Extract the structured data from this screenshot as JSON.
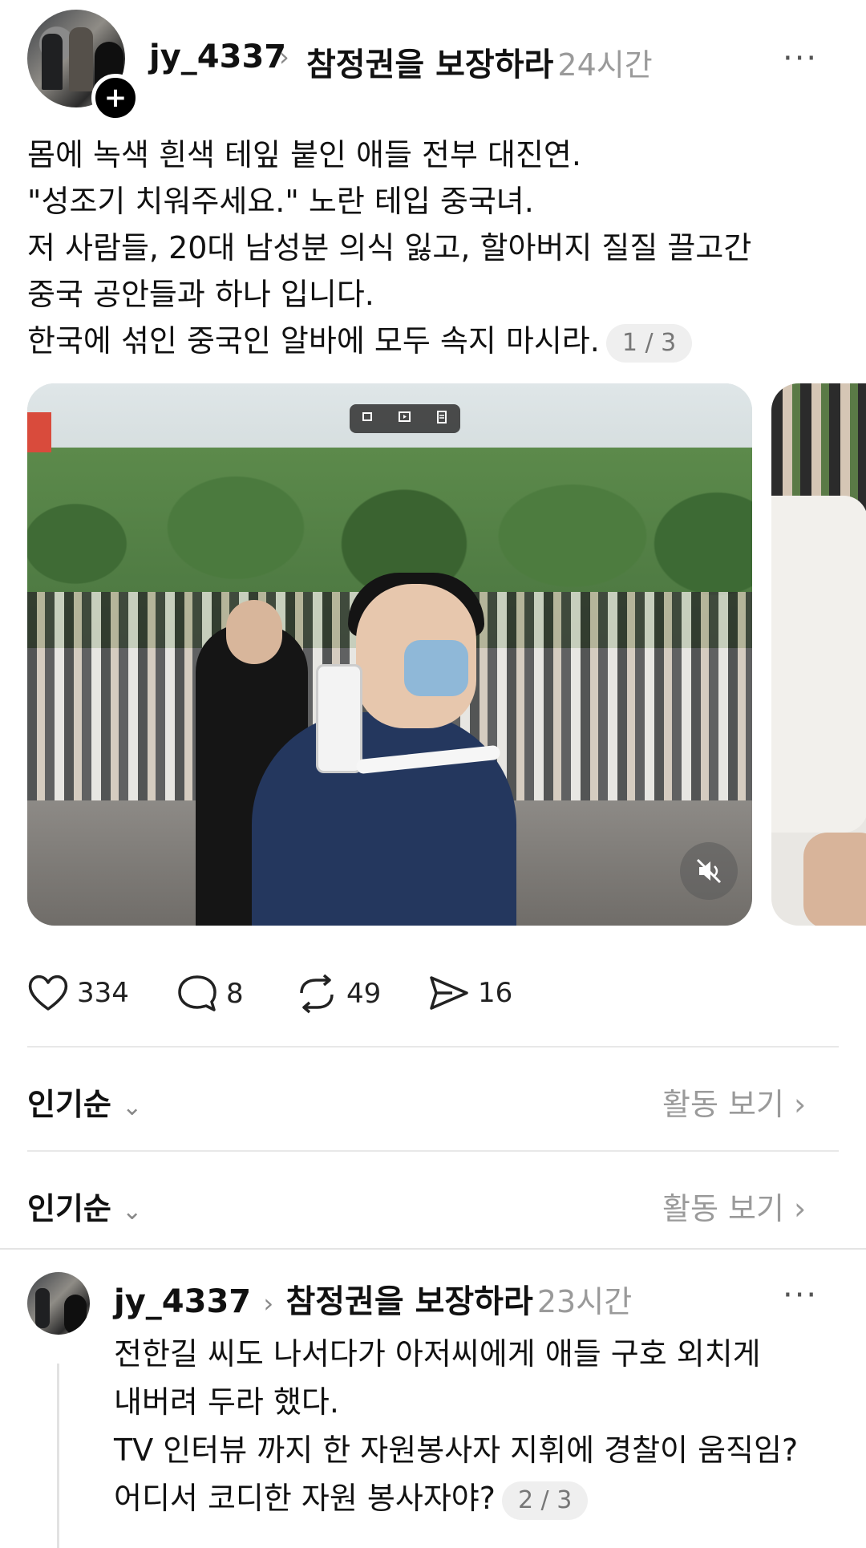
{
  "post": {
    "username": "jy_4337",
    "topic": "참정권을 보장하라",
    "time": "24시간",
    "more": "···",
    "lines": [
      "몸에 녹색 흰색 테잎 붙인 애들 전부 대진연.",
      "\"성조기 치워주세요.\" 노란 테입 중국녀.",
      "저 사람들, 20대 남성분 의식 잃고, 할아버지 질질 끌고간",
      "중국 공안들과 하나 입니다.",
      "한국에 섞인 중국인 알바에 모두 속지 마시라."
    ],
    "counter": "1 / 3",
    "icons": {
      "follow": "plus-icon",
      "mute": "muted-speaker-icon",
      "toolbar": [
        "crop-icon",
        "play-icon",
        "document-icon"
      ]
    },
    "stats": {
      "likes": "334",
      "comments": "8",
      "reposts": "49",
      "shares": "16"
    }
  },
  "sort_rows": [
    {
      "label": "인기순",
      "activity": "활동 보기"
    },
    {
      "label": "인기순",
      "activity": "활동 보기"
    }
  ],
  "reply": {
    "username": "jy_4337",
    "topic": "참정권을 보장하라",
    "time": "23시간",
    "more": "···",
    "lines": [
      "전한길 씨도 나서다가 아저씨에게 애들 구호 외치게",
      "내버려 두라 했다.",
      "TV 인터뷰 까지 한 자원봉사자 지휘에 경찰이 움직임?",
      "어디서 코디한 자원 봉사자야?"
    ],
    "counter": "2 / 3"
  },
  "colors": {
    "text": "#111111",
    "muted": "#9a9a9a",
    "divider": "#e8e8e8",
    "pill": "#efefef"
  }
}
